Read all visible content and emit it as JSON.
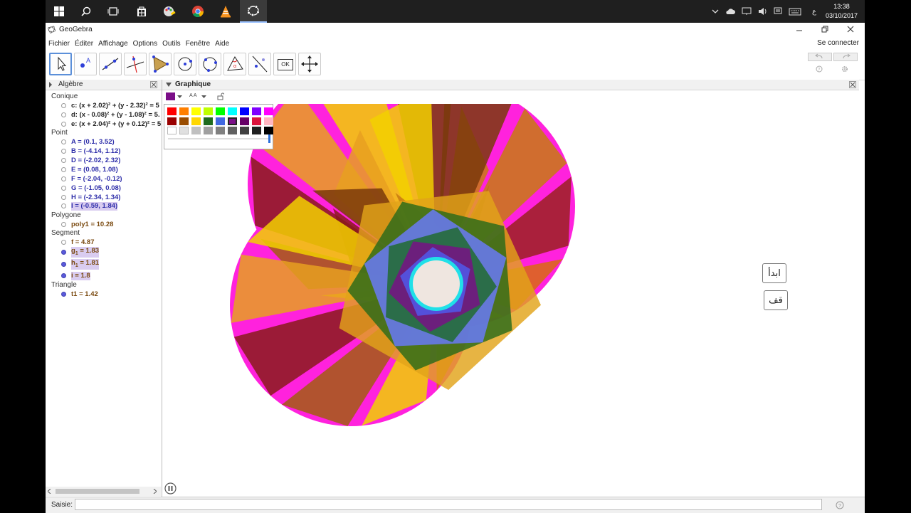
{
  "taskbar": {
    "keyboard_indicator": "ع",
    "clock_time": "13:38",
    "clock_date": "03/10/2017"
  },
  "window": {
    "title": "GeoGebra",
    "login_label": "Se connecter"
  },
  "menu": [
    "Fichier",
    "Éditer",
    "Affichage",
    "Options",
    "Outils",
    "Fenêtre",
    "Aide"
  ],
  "toolbar": {
    "ok_label": "OK"
  },
  "algebra": {
    "title": "Algèbre",
    "categories": {
      "conique": "Conique",
      "point": "Point",
      "polygone": "Polygone",
      "segment": "Segment",
      "triangle": "Triangle"
    },
    "conics": [
      "c: (x + 2.02)² + (y - 2.32)² = 5",
      "d: (x - 0.08)² + (y - 1.08)² = 5.",
      "e: (x + 2.04)² + (y + 0.12)² = 5"
    ],
    "points": [
      "A = (0.1, 3.52)",
      "B = (-4.14, 1.12)",
      "D = (-2.02, 2.32)",
      "E = (0.08, 1.08)",
      "F = (-2.04, -0.12)",
      "G = (-1.05, 0.08)",
      "H = (-2.34, 1.34)",
      "I = (-0.59, 1.84)"
    ],
    "polygons": [
      "poly1 = 10.28"
    ],
    "segments": {
      "f": "f = 4.87",
      "g_name": "g",
      "g_sub": "1",
      "g_val": " = 1.83",
      "h_name": "h",
      "h_sub": "1",
      "h_val": " = 1.81",
      "i": "i = 1.8"
    },
    "triangles": [
      "t1 = 1.42"
    ]
  },
  "graphics": {
    "title": "Graphique",
    "text_size_label": "A A",
    "start_button": "ابدأ",
    "stop_button": "قف"
  },
  "input": {
    "label": "Saisie:"
  },
  "colors": {
    "selected_color": "#7b0e88",
    "palette_row1": [
      "#ff0000",
      "#ff7f00",
      "#ffff00",
      "#bfff00",
      "#00ff00",
      "#00ffff",
      "#0000ff",
      "#7f00ff",
      "#ff00ff"
    ],
    "palette_row2": [
      "#990000",
      "#994c00",
      "#ffd700",
      "#1e6b1e",
      "#4169e1",
      "#7b0e88",
      "#660066",
      "#dc143c",
      "#ffb6c1"
    ],
    "palette_row3": [
      "#ffffff",
      "#e0e0e0",
      "#c0c0c0",
      "#a0a0a0",
      "#808080",
      "#606060",
      "#404040",
      "#202020",
      "#000000"
    ]
  }
}
